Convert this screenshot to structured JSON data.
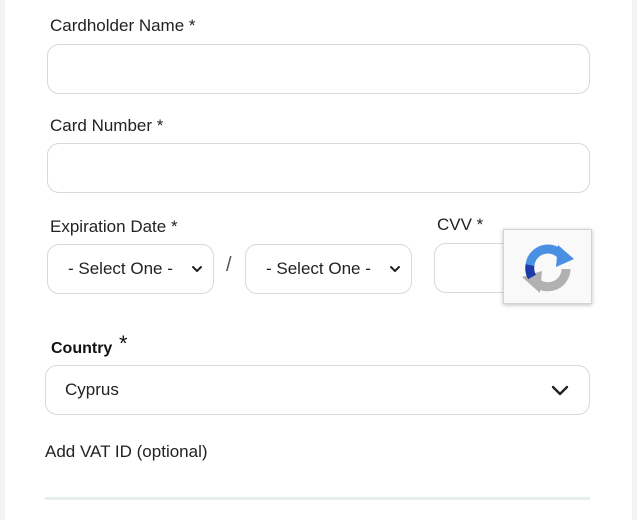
{
  "cardholder": {
    "label": "Cardholder Name *",
    "value": ""
  },
  "card_number": {
    "label": "Card Number *",
    "value": ""
  },
  "expiration": {
    "label": "Expiration Date *",
    "month_value": "- Select One -",
    "year_value": "- Select One -",
    "separator": "/"
  },
  "cvv": {
    "label": "CVV *",
    "value": ""
  },
  "country": {
    "label": "Country",
    "required_mark": "*",
    "value": "Cyprus"
  },
  "vat": {
    "label": "Add VAT ID (optional)"
  },
  "icons": {
    "select_arrow": "chevron-down-icon",
    "recaptcha": "recaptcha-icon"
  },
  "colors": {
    "border": "#d9d9d9",
    "recaptcha_blue": "#4a90e2",
    "recaptcha_gray": "#b1b1b1",
    "divider": "#e6eeee"
  }
}
